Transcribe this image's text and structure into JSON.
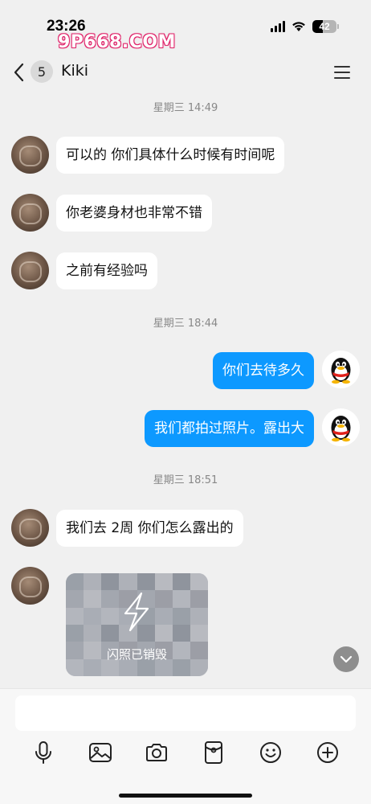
{
  "status_bar": {
    "time": "23:26",
    "watermark": "9P668.COM",
    "battery_level": "42",
    "battery_fraction": 0.42
  },
  "header": {
    "unread_count": "5",
    "contact_name": "Kiki"
  },
  "chat": {
    "timestamps": [
      "星期三 14:49",
      "星期三 18:44",
      "星期三 18:51"
    ],
    "messages": [
      {
        "direction": "in",
        "text": "可以的 你们具体什么时候有时间呢"
      },
      {
        "direction": "in",
        "text": "你老婆身材也非常不错"
      },
      {
        "direction": "in",
        "text": "之前有经验吗"
      },
      {
        "direction": "out",
        "text": "你们去待多久"
      },
      {
        "direction": "out",
        "text": "我们都拍过照片。露出大"
      },
      {
        "direction": "in",
        "text": "我们去 2周 你们怎么露出的"
      }
    ],
    "flash_photo_label": "闪照已销毁"
  },
  "input": {
    "placeholder": ""
  },
  "toolbar": {
    "icons": [
      "microphone-icon",
      "image-icon",
      "camera-icon",
      "red-packet-icon",
      "emoji-icon",
      "plus-icon"
    ]
  },
  "colors": {
    "outgoing_bubble": "#0d99ff",
    "incoming_bubble": "#ffffff",
    "background": "#f0f0f0",
    "watermark_outline": "#e0246a"
  }
}
